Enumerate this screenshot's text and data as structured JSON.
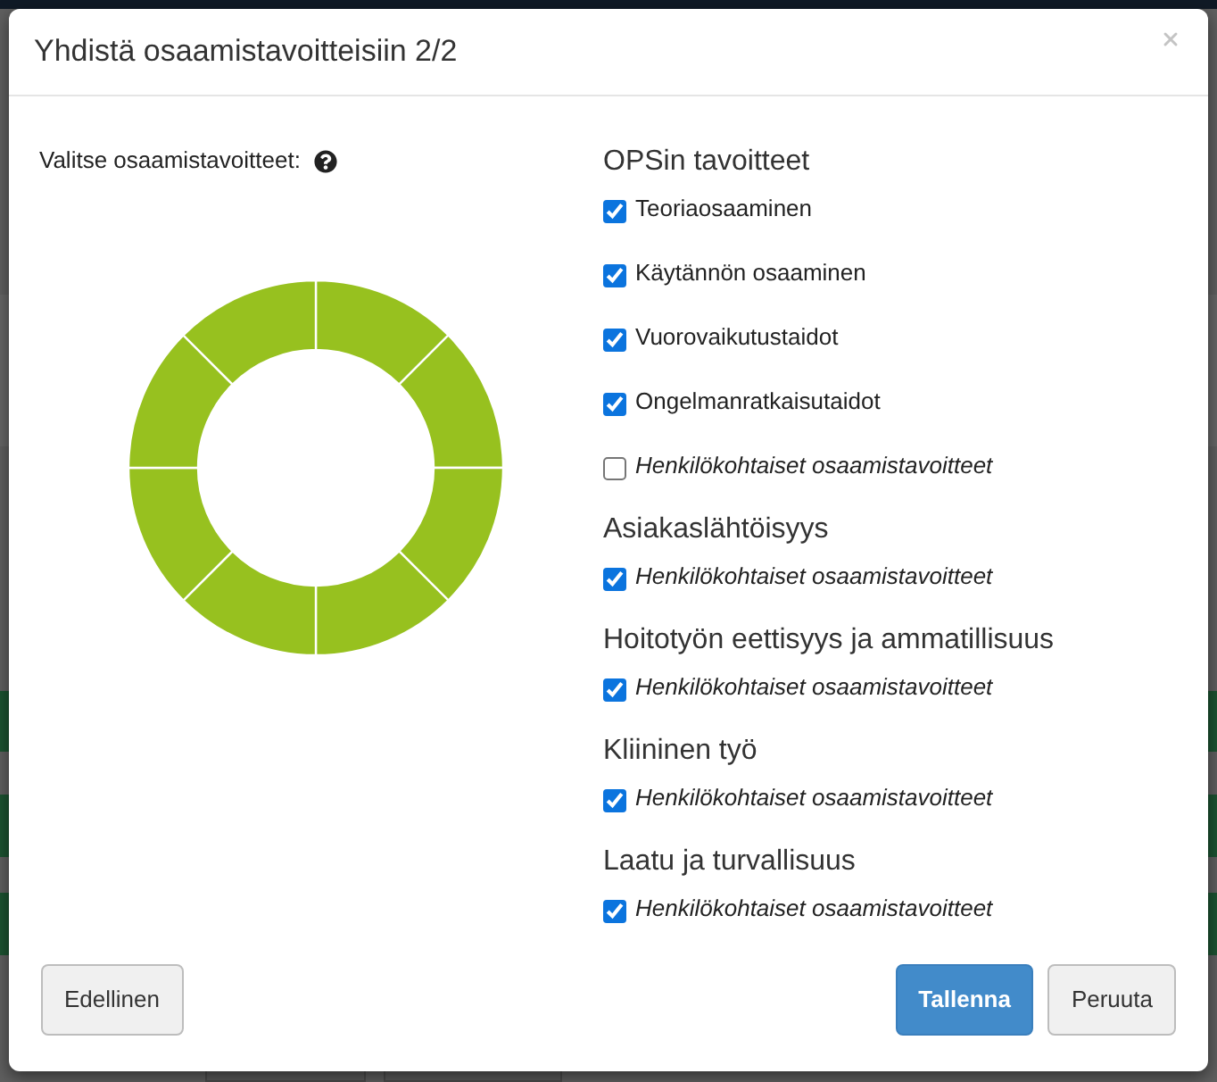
{
  "dialog": {
    "title": "Yhdistä osaamistavoitteisiin 2/2"
  },
  "selector": {
    "label": "Valitse osaamistavoitteet:"
  },
  "goal_groups": [
    {
      "heading": "OPSin tavoitteet",
      "items": [
        {
          "label": "Teoriaosaaminen",
          "kind": "standard",
          "checked": true
        },
        {
          "label": "Käytännön osaaminen",
          "kind": "standard",
          "checked": true
        },
        {
          "label": "Vuorovaikutustaidot",
          "kind": "standard",
          "checked": true
        },
        {
          "label": "Ongelmanratkaisutaidot",
          "kind": "standard",
          "checked": true
        },
        {
          "label": "Henkilökohtaiset osaamistavoitteet",
          "kind": "personal",
          "checked": false
        }
      ]
    },
    {
      "heading": "Asiakaslähtöisyys",
      "items": [
        {
          "label": "Henkilökohtaiset osaamistavoitteet",
          "kind": "personal",
          "checked": true
        }
      ]
    },
    {
      "heading": "Hoitotyön eettisyys ja ammatillisuus",
      "items": [
        {
          "label": "Henkilökohtaiset osaamistavoitteet",
          "kind": "personal",
          "checked": true
        }
      ]
    },
    {
      "heading": "Kliininen työ",
      "items": [
        {
          "label": "Henkilökohtaiset osaamistavoitteet",
          "kind": "personal",
          "checked": true
        }
      ]
    },
    {
      "heading": "Laatu ja turvallisuus",
      "items": [
        {
          "label": "Henkilökohtaiset osaamistavoitteet",
          "kind": "personal",
          "checked": true
        }
      ]
    }
  ],
  "footer": {
    "left_buttons": [
      {
        "label": "Edellinen",
        "kind": "default"
      }
    ],
    "right_buttons": [
      {
        "label": "Tallenna",
        "kind": "primary"
      },
      {
        "label": "Peruuta",
        "kind": "default"
      }
    ]
  }
}
